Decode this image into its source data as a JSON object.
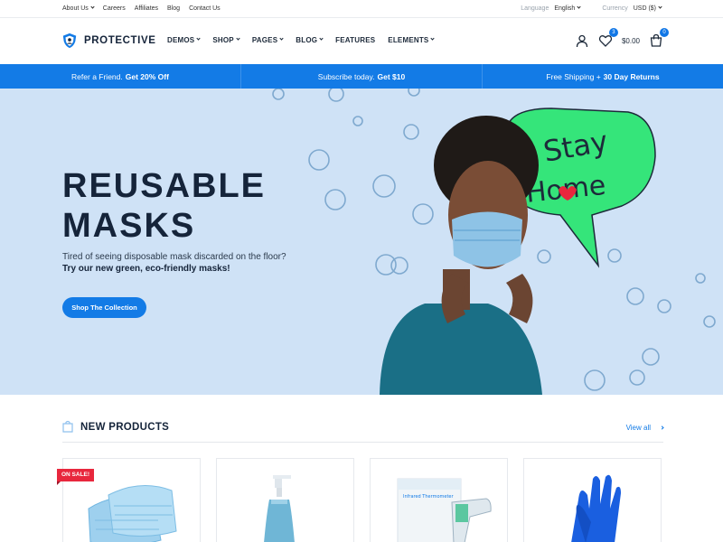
{
  "topbar": {
    "links": [
      "About Us",
      "Careers",
      "Affiliates",
      "Blog",
      "Contact Us"
    ],
    "language_label": "Language",
    "language_value": "English",
    "currency_label": "Currency",
    "currency_value": "USD ($)"
  },
  "header": {
    "logo_text": "PROTECTIVE",
    "nav": [
      {
        "label": "DEMOS",
        "dropdown": true
      },
      {
        "label": "SHOP",
        "dropdown": true
      },
      {
        "label": "PAGES",
        "dropdown": true
      },
      {
        "label": "BLOG",
        "dropdown": true
      },
      {
        "label": "FEATURES",
        "dropdown": false
      },
      {
        "label": "ELEMENTS",
        "dropdown": true
      }
    ],
    "wishlist_count": "3",
    "cart_total": "$0.00",
    "cart_count": "0",
    "icons": [
      "user-icon",
      "heart-icon",
      "cart-icon"
    ]
  },
  "promo": {
    "items": [
      {
        "text": "Refer a Friend.",
        "bold": "Get 20% Off"
      },
      {
        "text": "Subscribe today.",
        "bold": "Get $10"
      },
      {
        "text": "Free Shipping +",
        "bold": "30 Day Returns"
      }
    ]
  },
  "hero": {
    "title_line1": "REUSABLE",
    "title_line2": "MASKS",
    "description": "Tired of seeing disposable mask discarded on the floor?",
    "description_bold": "Try our new green, eco-friendly masks!",
    "button_label": "Shop The Collection",
    "bubble_text_1": "Stay",
    "bubble_text_2": "Home"
  },
  "new_products": {
    "title": "NEW PRODUCTS",
    "view_all": "View all",
    "sale_badge": "ON SALE!",
    "products": [
      "surgical-masks-image",
      "sanitizer-bottle-image",
      "infrared-thermometer-image",
      "blue-gloves-image"
    ],
    "thermometer_box_label": "Infrared Thermometer"
  },
  "colors": {
    "accent": "#137be6",
    "hero_bg": "#cfe2f6",
    "sale": "#e8273d",
    "bubble": "#35e57a",
    "dark": "#15243a"
  }
}
